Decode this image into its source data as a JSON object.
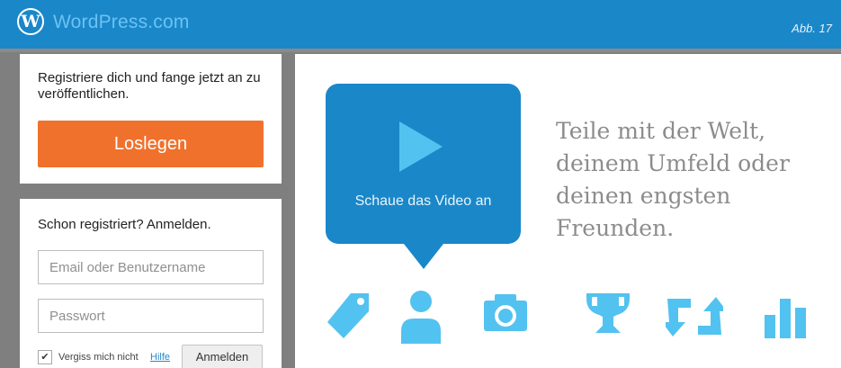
{
  "header": {
    "logo_letter": "W",
    "brand": "WordPress.com",
    "figure_tag": "Abb. 17"
  },
  "register": {
    "text": "Registriere dich und fange jetzt an zu veröffentlichen.",
    "button_label": "Loslegen"
  },
  "login": {
    "heading": "Schon registriert? Anmelden.",
    "email_placeholder": "Email oder Benutzername",
    "password_placeholder": "Passwort",
    "remember_label": "Vergiss mich nicht",
    "remember_checked": true,
    "check_glyph": "✔",
    "help_label": "Hilfe",
    "submit_label": "Anmelden"
  },
  "promo": {
    "video_caption": "Schaue das Video an",
    "tagline": "Teile mit der Welt, deinem Umfeld oder deinen engsten Freunden."
  },
  "feature_icons": [
    "tag-icon",
    "person-icon",
    "camera-icon",
    "trophy-icon",
    "reblog-icon",
    "stats-icon"
  ],
  "colors": {
    "brand_blue": "#1a87c9",
    "icon_blue": "#52c2f0",
    "cta_orange": "#f0712c",
    "tagline_gray": "#8c8c8c"
  }
}
